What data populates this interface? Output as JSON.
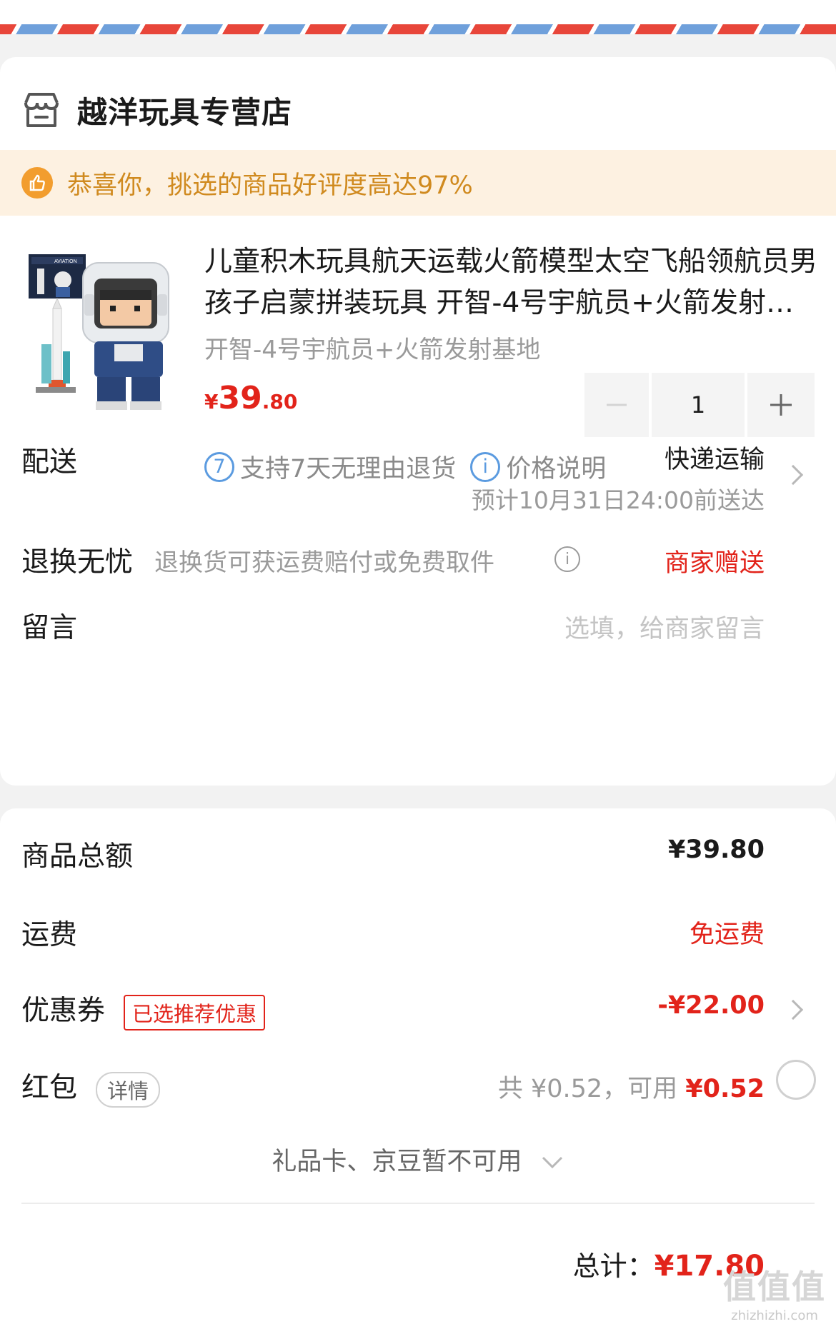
{
  "store": {
    "name": "越洋玩具专营店",
    "icon": "store-icon"
  },
  "praise": {
    "text": "恭喜你，挑选的商品好评度高达97%",
    "icon": "thumbs-up-icon",
    "color": "#f29d2e"
  },
  "product": {
    "title": "儿童积木玩具航天运载火箭模型太空飞船领航员男孩子启蒙拼装玩具 开智-4号宇航员+火箭发射基地",
    "spec": "开智-4号宇航员+火箭发射基地",
    "price_yen": "¥",
    "price_int": "39",
    "price_dec": ".80",
    "quantity": "1",
    "promise_icon_label": "7",
    "promise_text": "支持7天无理由退货",
    "price_note_icon_label": "i",
    "price_note": "价格说明",
    "box_label": "AVIATION"
  },
  "delivery": {
    "label": "配送",
    "method": "快递运输",
    "eta": "预计10月31日24:00前送达"
  },
  "returns": {
    "label": "退换无忧",
    "desc": "退换货可获运费赔付或免费取件",
    "value": "商家赠送",
    "info_icon_label": "i"
  },
  "message": {
    "label": "留言",
    "placeholder": "选填，给商家留言"
  },
  "summary": {
    "goods_label": "商品总额",
    "goods_value": "¥39.80",
    "shipping_label": "运费",
    "shipping_value": "免运费",
    "coupon_label": "优惠券",
    "coupon_tag": "已选推荐优惠",
    "coupon_value": "-¥22.00",
    "redpack_label": "红包",
    "redpack_detail": "详情",
    "redpack_total": "共 ¥0.52，",
    "redpack_available_label": "可用 ",
    "redpack_available": "¥0.52",
    "giftcard_text": "礼品卡、京豆暂不可用",
    "total_label": "总计：",
    "total_value": "¥17.80"
  },
  "watermark": {
    "main": "值值值",
    "sub": "zhizhizhi.com"
  },
  "colors": {
    "accent_red": "#e2231a",
    "blue_icon": "#5b9be0",
    "praise_bg": "#fdf1e1"
  }
}
